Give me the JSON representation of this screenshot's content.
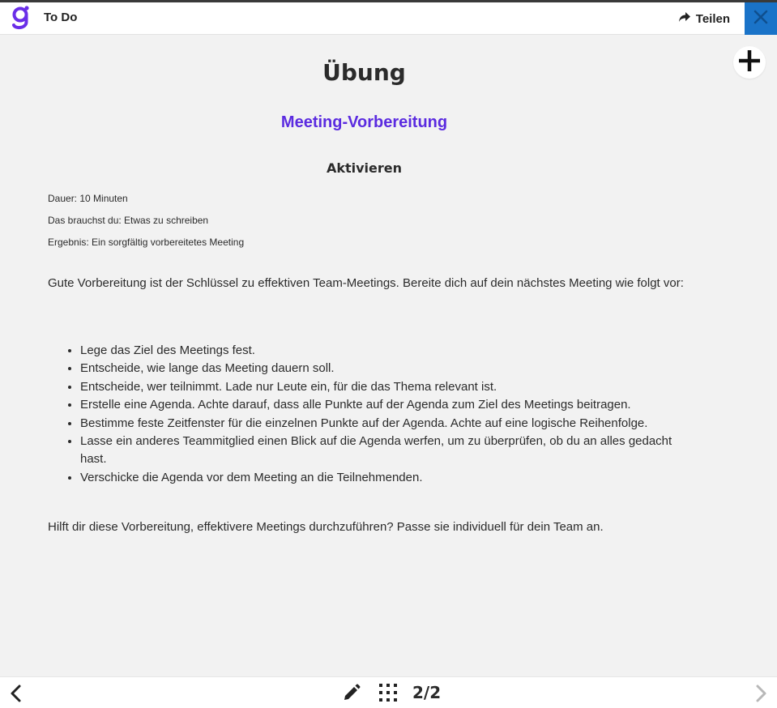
{
  "header": {
    "app_title": "To Do",
    "share_label": "Teilen"
  },
  "content": {
    "title": "Übung",
    "subtitle": "Meeting-Vorbereitung",
    "section": "Aktivieren",
    "meta": {
      "duration": "Dauer: 10 Minuten",
      "needs": "Das brauchst du: Etwas zu schreiben",
      "result": "Ergebnis: Ein sorgfältig vorbereitetes Meeting"
    },
    "intro": "Gute Vorbereitung ist der Schlüssel zu effektiven Team-Meetings. Bereite dich auf dein nächstes Meeting wie folgt vor:",
    "steps": [
      "Lege das Ziel des Meetings fest.",
      "Entscheide, wie lange das Meeting dauern soll.",
      "Entscheide, wer teilnimmt. Lade nur Leute ein, für die das Thema relevant ist.",
      "Erstelle eine Agenda. Achte darauf, dass alle Punkte auf der Agenda zum Ziel des Meetings beitragen.",
      "Bestimme feste Zeitfenster für die einzelnen Punkte auf der Agenda. Achte auf eine logische Reihenfolge.",
      "Lasse ein anderes Teammitglied einen Blick auf die Agenda werfen, um zu überprüfen, ob du an alles gedacht hast.",
      "Verschicke die Agenda vor dem Meeting an die Teilnehmenden."
    ],
    "outro": "Hilft dir diese Vorbereitung, effektivere Meetings durchzuführen? Passe sie individuell für dein Team an."
  },
  "footer": {
    "page_counter": "2/2"
  },
  "icons": {
    "logo": "goodhabitz-g-logo",
    "share": "share-arrow-icon",
    "close": "close-icon",
    "add": "plus-icon",
    "prev": "chevron-left-icon",
    "next": "chevron-right-icon",
    "edit": "pencil-icon",
    "grid": "grid-icon"
  },
  "colors": {
    "accent": "#5b2be0",
    "close_bg": "#1a73c8",
    "background": "#f2f2f2"
  }
}
